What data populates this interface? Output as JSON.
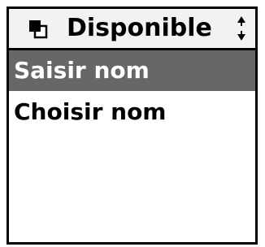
{
  "header": {
    "title": "Disponible",
    "status_icon": "availability-icon",
    "scroll_icon": "scroll-arrows-icon"
  },
  "list": {
    "items": [
      {
        "label": "Saisir nom",
        "selected": true
      },
      {
        "label": "Choisir nom",
        "selected": false
      }
    ]
  },
  "colors": {
    "border": "#000000",
    "header_bg": "#f2f2f2",
    "selected_bg": "#676767",
    "selected_text": "#ffffff",
    "text": "#000000"
  }
}
